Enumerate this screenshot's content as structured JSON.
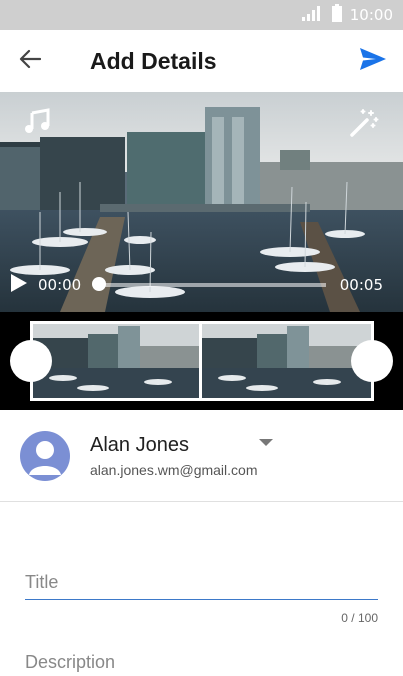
{
  "status_bar": {
    "time": "10:00",
    "icons": [
      "signal-icon",
      "battery-icon"
    ]
  },
  "app_bar": {
    "title": "Add Details",
    "back_icon": "arrow-back-icon",
    "send_icon": "send-icon",
    "accent": "#1a73e8"
  },
  "video": {
    "time_current": "00:00",
    "time_total": "00:05",
    "progress": 0.0,
    "icons": [
      "music-note-icon",
      "magic-wand-icon",
      "play-icon"
    ]
  },
  "account": {
    "name": "Alan Jones",
    "email": "alan.jones.wm@gmail.com",
    "avatar_color": "#7b8fd4"
  },
  "form": {
    "title_placeholder": "Title",
    "title_value": "",
    "title_counter": "0 / 100",
    "description_placeholder": "Description",
    "description_value": "",
    "underline_color": "#3d79c9"
  }
}
